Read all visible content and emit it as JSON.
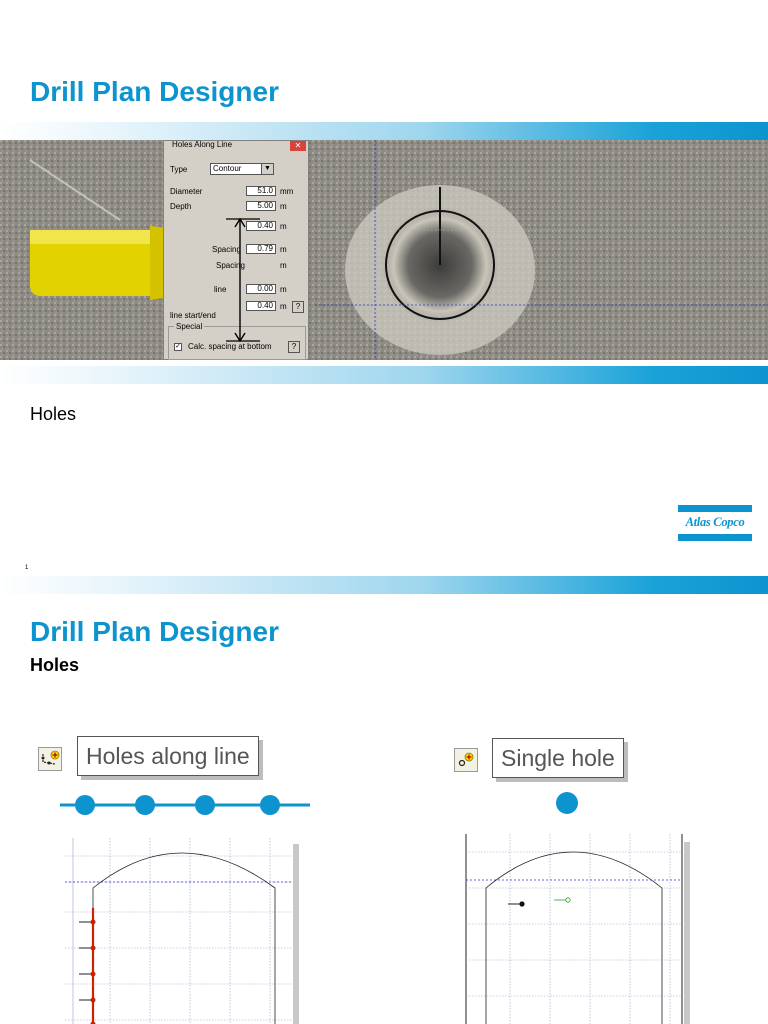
{
  "slide1": {
    "title": "Drill Plan Designer",
    "subtitle": "Holes",
    "page_number": "1",
    "dialog": {
      "caption": "Holes Along Line",
      "type_label": "Type",
      "type_value": "Contour",
      "diameter_label": "Diameter",
      "diameter_value": "51.0",
      "diameter_unit": "mm",
      "depth_label": "Depth",
      "depth_value": "5.00",
      "depth_unit": "m",
      "field3_value": "0.40",
      "field3_unit": "m",
      "spacing_label": "Spacing",
      "spacing_value": "0.79",
      "spacing_unit": "m",
      "spacing2_label": "Spacing",
      "spacing2_unit": "m",
      "line_label": "line",
      "line_value": "0.00",
      "line_unit": "m",
      "field6_value": "0.40",
      "field6_unit": "m",
      "line_start_label": "line start/end",
      "special_label": "Special",
      "checkbox_label": "Calc. spacing at bottom",
      "checkbox_checked": true,
      "help_glyph": "?"
    }
  },
  "logo": {
    "text": "Atlas Copco",
    "color": "#0d94cf"
  },
  "slide2": {
    "title": "Drill Plan Designer",
    "subtitle": "Holes",
    "left": {
      "label": "Holes along line",
      "icon": "holes-along-line-tool-icon"
    },
    "right": {
      "label": "Single hole",
      "icon": "single-hole-tool-icon"
    }
  },
  "colors": {
    "accent": "#0d94cf",
    "hole": "#0d94cf",
    "contour": "#cc2200"
  }
}
